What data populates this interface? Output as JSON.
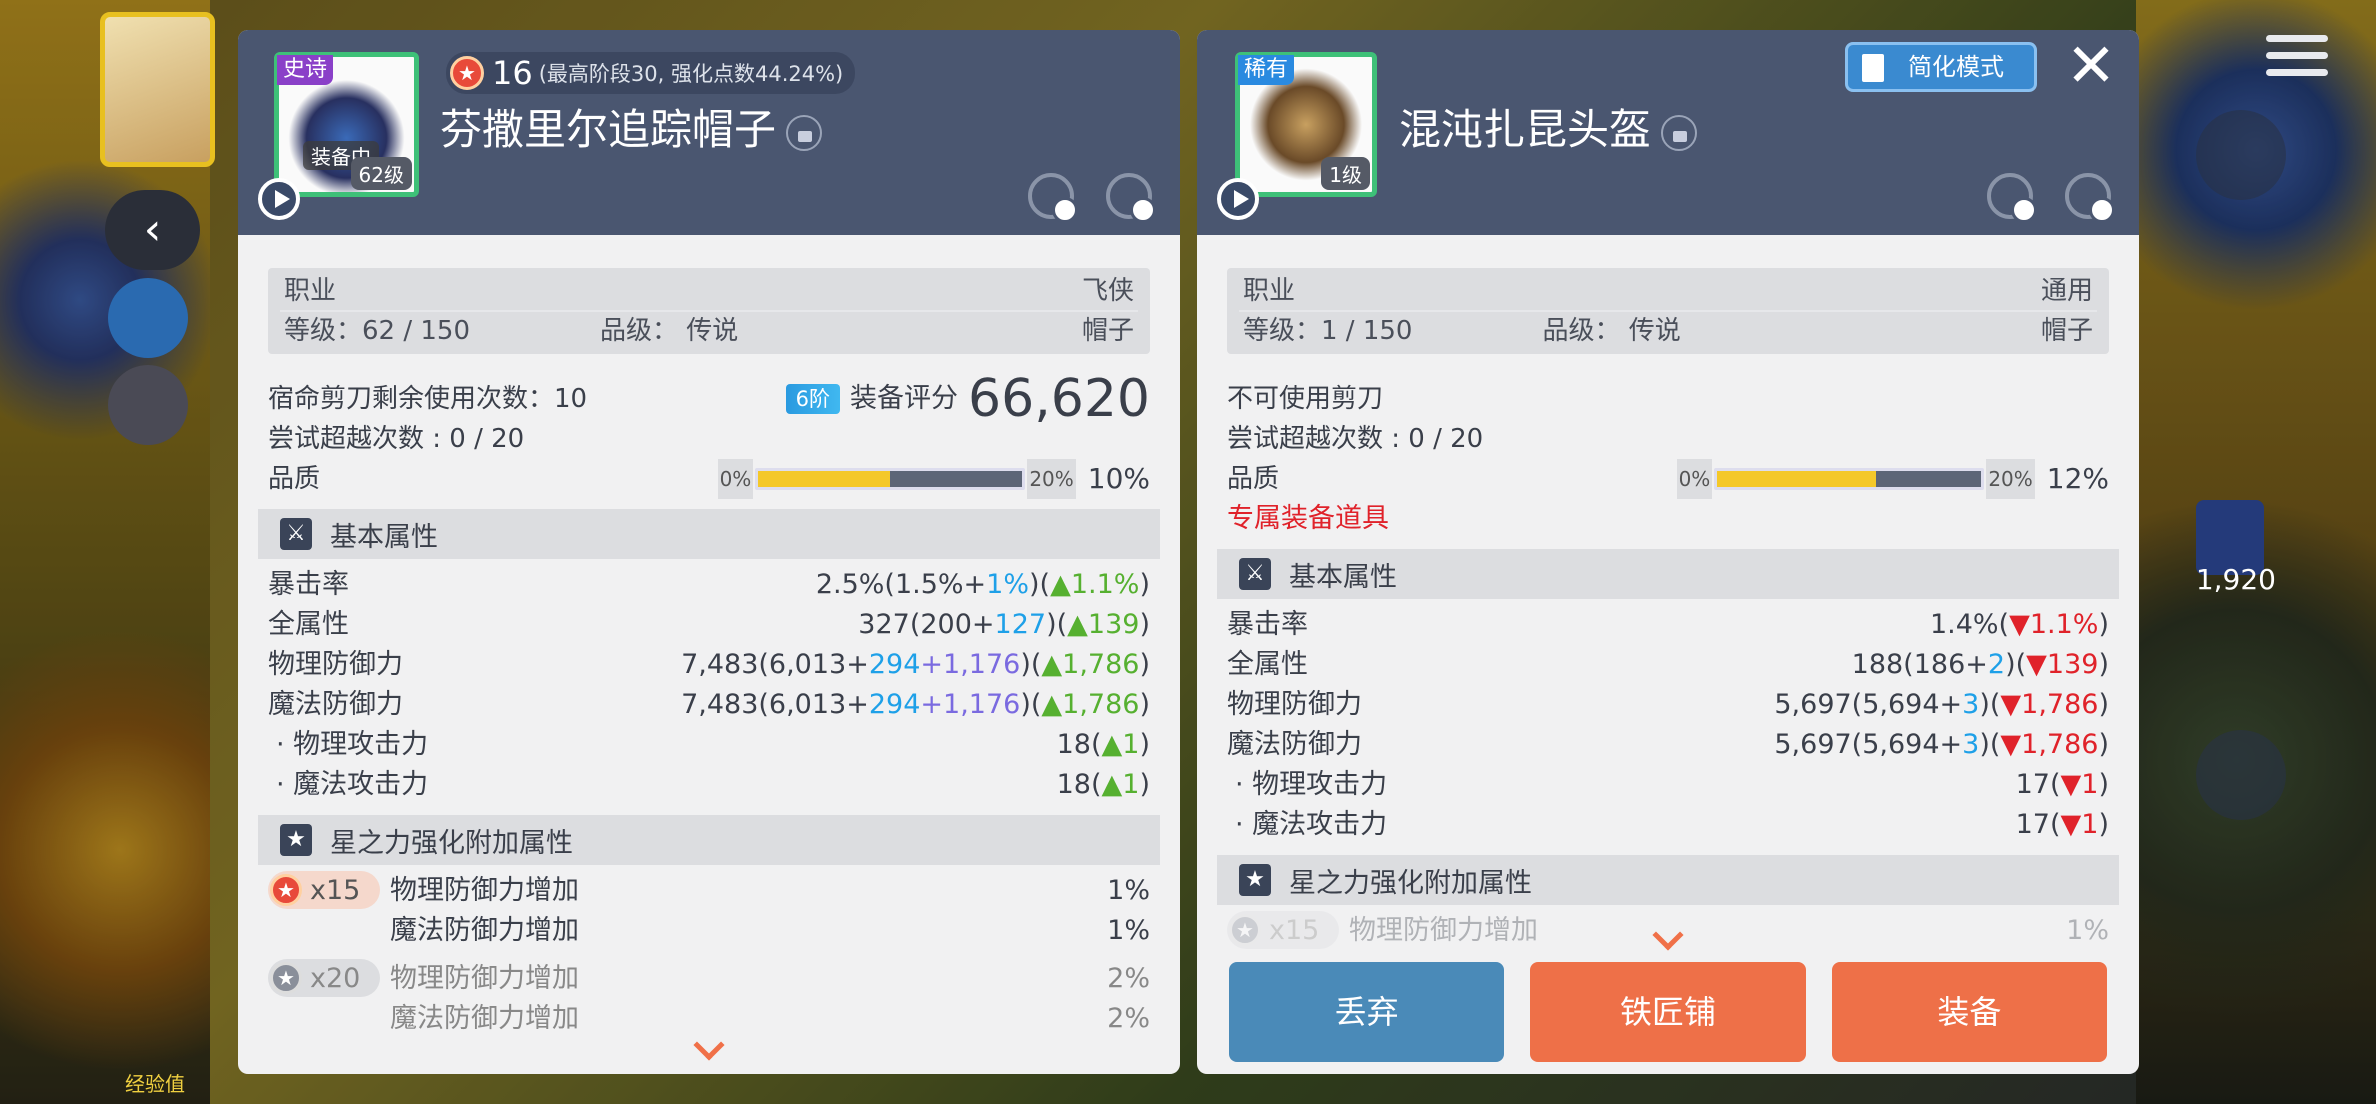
{
  "background": {
    "exp_label": "经验值",
    "potion_count": "1,920"
  },
  "left": {
    "grade": "史诗",
    "equipped_tag": "装备中",
    "item_level": "62级",
    "star_count": "16",
    "star_note": "(最高阶段30, 强化点数44.24%)",
    "name": "芬撒里尔追踪帽子",
    "job_label": "职业",
    "job_value": "飞侠",
    "level_label": "等级：62 / 150",
    "grade_label": "品级： 传说",
    "type_value": "帽子",
    "scissors": "宿命剪刀剩余使用次数：10",
    "transcend": "尝试超越次数 : 0 / 20",
    "tier": "6阶",
    "score_label": "装备评分",
    "score_value": "66,620",
    "quality_label": "品质",
    "q_min": "0%",
    "q_max": "20%",
    "q_value": "10%",
    "q_fill": 0.5,
    "basic_title": "基本属性",
    "stats": [
      {
        "k": "暴击率",
        "base": "2.5%(1.5%+",
        "add1": "1%",
        "add2": "",
        "tail": ")(",
        "diff": "▲1.1%",
        "end": ")"
      },
      {
        "k": "全属性",
        "base": "327(200+",
        "add1": "127",
        "add2": "",
        "tail": ")(",
        "diff": "▲139",
        "end": ")"
      },
      {
        "k": "物理防御力",
        "base": "7,483(6,013+",
        "add1": "294",
        "add2": "+1,176",
        "tail": ")(",
        "diff": "▲1,786",
        "end": ")"
      },
      {
        "k": "魔法防御力",
        "base": "7,483(6,013+",
        "add1": "294",
        "add2": "+1,176",
        "tail": ")(",
        "diff": "▲1,786",
        "end": ")"
      },
      {
        "k": "· 物理攻击力",
        "base": "18(",
        "add1": "",
        "add2": "",
        "tail": "",
        "diff": "▲1",
        "end": ")"
      },
      {
        "k": "· 魔法攻击力",
        "base": "18(",
        "add1": "",
        "add2": "",
        "tail": "",
        "diff": "▲1",
        "end": ")"
      }
    ],
    "star_title": "星之力强化附加属性",
    "star_groups": [
      {
        "badge": "x15",
        "lines": [
          {
            "k": "物理防御力增加",
            "v": "1%"
          },
          {
            "k": "魔法防御力增加",
            "v": "1%"
          }
        ]
      },
      {
        "badge": "x20",
        "lines": [
          {
            "k": "物理防御力增加",
            "v": "2%"
          },
          {
            "k": "魔法防御力增加",
            "v": "2%"
          }
        ]
      }
    ]
  },
  "right": {
    "grade": "稀有",
    "item_level": "1级",
    "name": "混沌扎昆头盔",
    "simple_mode": "简化模式",
    "close": "✕",
    "job_label": "职业",
    "job_value": "通用",
    "level_label": "等级：1 / 150",
    "grade_label": "品级： 传说",
    "type_value": "帽子",
    "scissors": "不可使用剪刀",
    "transcend": "尝试超越次数 : 0 / 20",
    "quality_label": "品质",
    "q_min": "0%",
    "q_max": "20%",
    "q_value": "12%",
    "q_fill": 0.6,
    "exclusive": "专属装备道具",
    "basic_title": "基本属性",
    "stats": [
      {
        "k": "暴击率",
        "base": "1.4%(",
        "add1": "",
        "tail": "",
        "diff": "▼1.1%",
        "end": ")"
      },
      {
        "k": "全属性",
        "base": "188(186+",
        "add1": "2",
        "tail": ")(",
        "diff": "▼139",
        "end": ")"
      },
      {
        "k": "物理防御力",
        "base": "5,697(5,694+",
        "add1": "3",
        "tail": ")(",
        "diff": "▼1,786",
        "end": ")"
      },
      {
        "k": "魔法防御力",
        "base": "5,697(5,694+",
        "add1": "3",
        "tail": ")(",
        "diff": "▼1,786",
        "end": ")"
      },
      {
        "k": "· 物理攻击力",
        "base": "17(",
        "add1": "",
        "tail": "",
        "diff": "▼1",
        "end": ")"
      },
      {
        "k": "· 魔法攻击力",
        "base": "17(",
        "add1": "",
        "tail": "",
        "diff": "▼1",
        "end": ")"
      }
    ],
    "star_title": "星之力强化附加属性",
    "star_peek": {
      "badge": "x15",
      "k": "物理防御力增加",
      "v": "1%"
    },
    "buttons": {
      "discard": "丢弃",
      "smith": "铁匠铺",
      "equip": "装备"
    }
  }
}
